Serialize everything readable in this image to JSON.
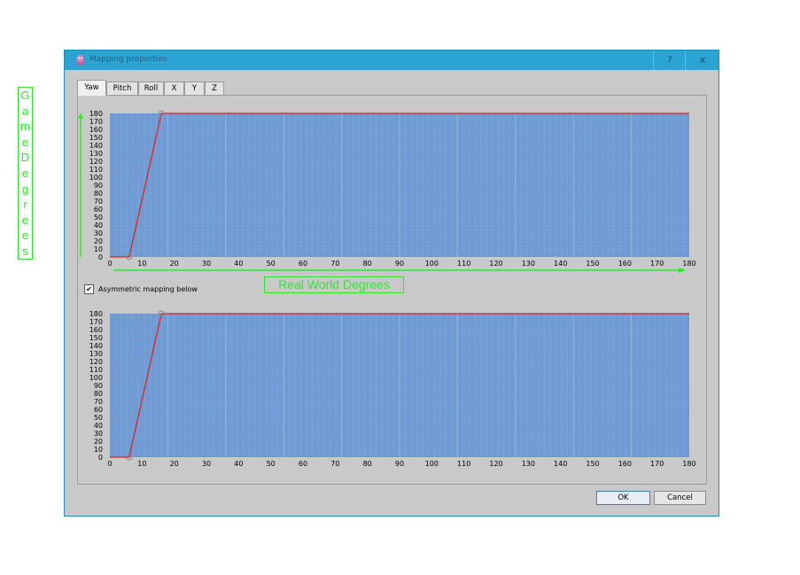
{
  "annotations": {
    "vertical_label": "GameDegrees",
    "horizontal_label": "Real World Degrees",
    "color": "#2ee82e"
  },
  "window": {
    "title": "Mapping properties",
    "help_label": "?",
    "close_label": "x",
    "icon": "octopus-app-icon"
  },
  "tabs": [
    "Yaw",
    "Pitch",
    "Roll",
    "X",
    "Y",
    "Z"
  ],
  "active_tab": "Yaw",
  "checkbox": {
    "label": "Asymmetric mapping below",
    "checked": true
  },
  "buttons": {
    "ok": "OK",
    "cancel": "Cancel"
  },
  "colors": {
    "plot_bg": "#6a96d0",
    "curve": "#e0201c",
    "grid": "#8fb2e0",
    "window_bg": "#c9c9c9",
    "titlebar": "#2ba4d3"
  },
  "chart_data": [
    {
      "type": "line",
      "name": "top",
      "x_ticks": [
        0,
        10,
        20,
        30,
        40,
        50,
        60,
        70,
        80,
        90,
        100,
        110,
        120,
        130,
        140,
        150,
        160,
        170,
        180
      ],
      "y_ticks": [
        0,
        10,
        20,
        30,
        40,
        50,
        60,
        70,
        80,
        90,
        100,
        110,
        120,
        130,
        140,
        150,
        160,
        170,
        180
      ],
      "xlim": [
        0,
        180
      ],
      "ylim": [
        0,
        180
      ],
      "grid": true,
      "points": [
        [
          0,
          0
        ],
        [
          6,
          0
        ],
        [
          16,
          180
        ],
        [
          180,
          180
        ]
      ],
      "handles": [
        [
          6,
          0
        ],
        [
          16,
          180
        ]
      ]
    },
    {
      "type": "line",
      "name": "bottom",
      "x_ticks": [
        0,
        10,
        20,
        30,
        40,
        50,
        60,
        70,
        80,
        90,
        100,
        110,
        120,
        130,
        140,
        150,
        160,
        170,
        180
      ],
      "y_ticks": [
        0,
        10,
        20,
        30,
        40,
        50,
        60,
        70,
        80,
        90,
        100,
        110,
        120,
        130,
        140,
        150,
        160,
        170,
        180
      ],
      "xlim": [
        0,
        180
      ],
      "ylim": [
        0,
        180
      ],
      "grid": true,
      "points": [
        [
          0,
          0
        ],
        [
          6,
          0
        ],
        [
          16,
          180
        ],
        [
          180,
          180
        ]
      ],
      "handles": [
        [
          6,
          0
        ],
        [
          16,
          180
        ]
      ]
    }
  ]
}
